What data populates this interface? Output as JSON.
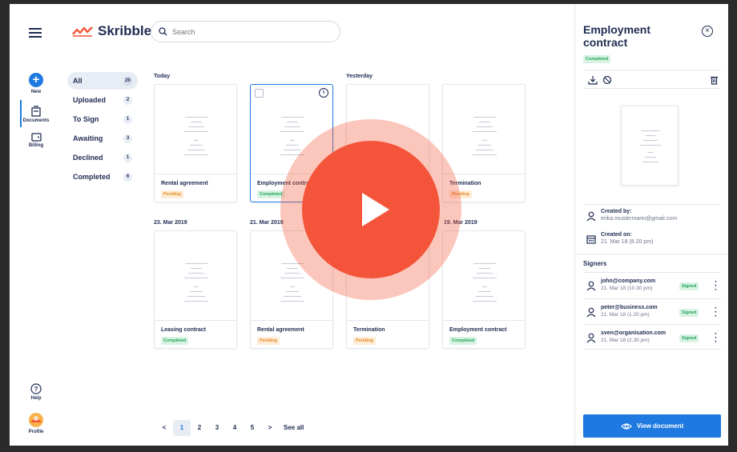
{
  "app": {
    "brand": "Skribble",
    "brand_color": "#f4553a",
    "accent_color": "#1e7ae0",
    "search_placeholder": "Search"
  },
  "rail": {
    "new_label": "New",
    "documents_label": "Documents",
    "billing_label": "Billing",
    "help_label": "Help",
    "profile_label": "Profile"
  },
  "filters": [
    {
      "label": "All",
      "count": "20"
    },
    {
      "label": "Uploaded",
      "count": "2"
    },
    {
      "label": "To Sign",
      "count": "1"
    },
    {
      "label": "Awaiting",
      "count": "3"
    },
    {
      "label": "Declined",
      "count": "1"
    },
    {
      "label": "Completed",
      "count": "6"
    }
  ],
  "groups": {
    "today": "Today",
    "yesterday": "Yesterday",
    "d1": "23. Mar 2019",
    "d2": "21. Mar 2019",
    "d4": "19. Mar 2019"
  },
  "documents": [
    {
      "title": "Rental agreement",
      "status": "Pending"
    },
    {
      "title": "Employment contract",
      "status": "Completed"
    },
    {
      "title": "Termination",
      "status": "Pending"
    },
    {
      "title": "Leasing contract",
      "status": "Completed"
    },
    {
      "title": "Rental agreement",
      "status": "Pending"
    },
    {
      "title": "Termination",
      "status": "Pending"
    },
    {
      "title": "Employment contract",
      "status": "Completed"
    }
  ],
  "pagination": {
    "prev": "<",
    "pages": [
      "1",
      "2",
      "3",
      "4",
      "5"
    ],
    "next": ">",
    "see_all": "See all"
  },
  "panel": {
    "title": "Employment contract",
    "status": "Completed",
    "created_by_label": "Created by:",
    "created_by": "erika.mustermann@gmail.com",
    "created_on_label": "Created on:",
    "created_on": "21. Mar 18 (8.20 pm)",
    "signers_label": "Signers",
    "signers": [
      {
        "email": "john@company.com",
        "date": "21. Mar 18 (10.30 pm)",
        "status": "Signed"
      },
      {
        "email": "peter@business.com",
        "date": "21. Mar 18 (1.20 pm)",
        "status": "Signed"
      },
      {
        "email": "sven@organisation.com",
        "date": "21. Mar 18 (2.30 pm)",
        "status": "Signed"
      }
    ],
    "view_button": "View document"
  }
}
